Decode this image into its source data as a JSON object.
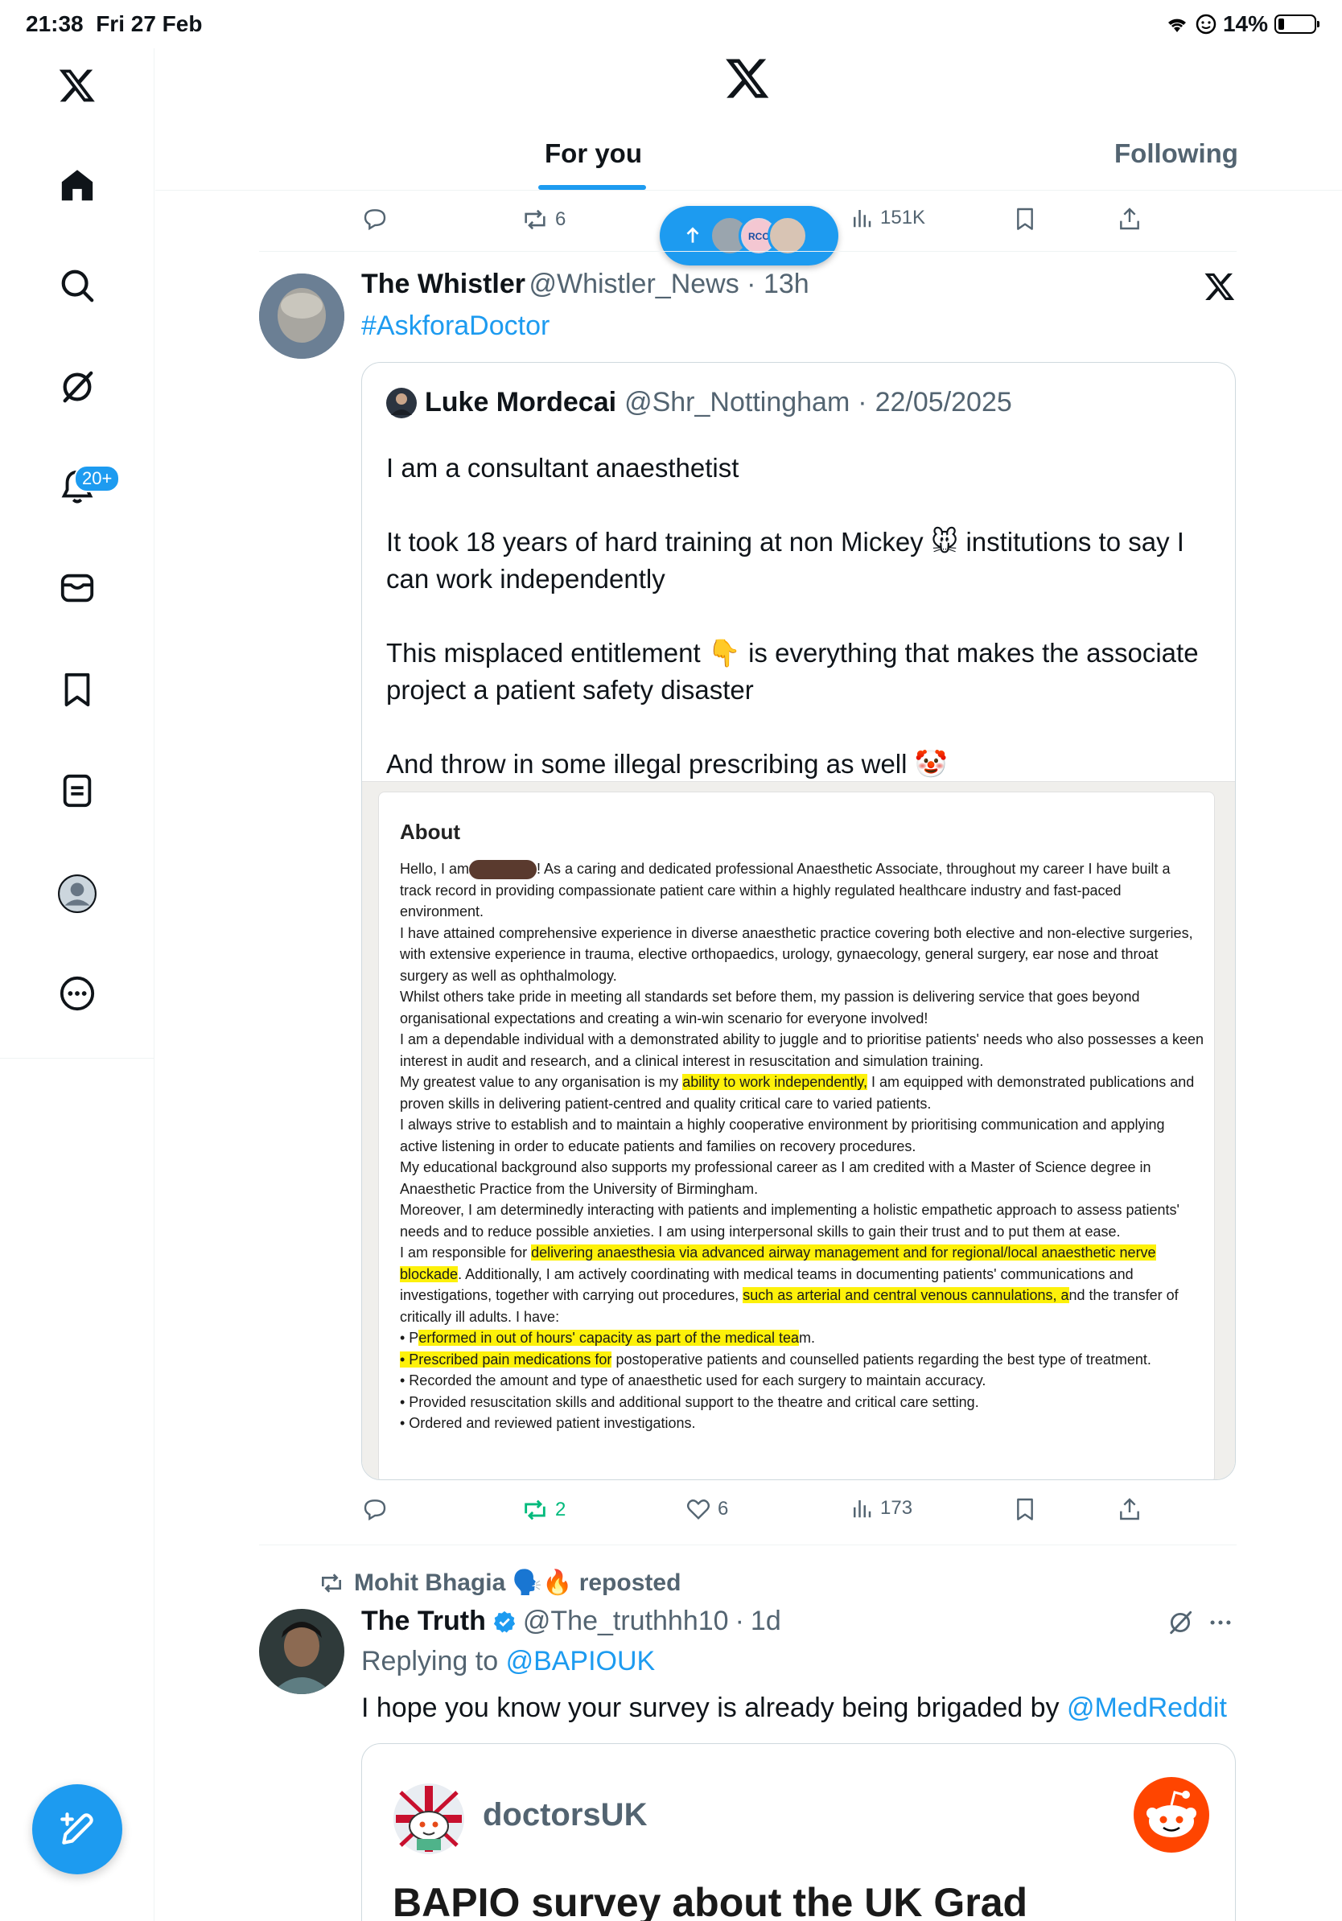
{
  "status_bar": {
    "time": "21:38",
    "date": "Fri 27 Feb",
    "battery": "14%"
  },
  "sidebar": {
    "notification_badge": "20+"
  },
  "tabs": {
    "for_you": "For you",
    "following": "Following"
  },
  "top_actions": {
    "retweets": "6",
    "views": "151K"
  },
  "post1": {
    "name": "The Whistler",
    "handle": "@Whistler_News",
    "time": "13h",
    "hashtag": "#AskforaDoctor",
    "quote": {
      "name": "Luke Mordecai",
      "handle": "@Shr_Nottingham",
      "date": "22/05/2025",
      "line1": "I am a consultant anaesthetist",
      "line2": "It took 18 years of hard training at non Mickey 🐭 institutions to say I can work independently",
      "line3": "This misplaced entitlement 👇 is everything that makes the associate project a patient safety disaster",
      "line4": "And throw in some illegal prescribing as well 🤡"
    },
    "image": {
      "heading": "About",
      "t01": "Hello, I am",
      "t02": "! As a caring and dedicated professional Anaesthetic Associate, throughout my career I have built a track record in providing compassionate patient care within a highly regulated healthcare industry and fast-paced environment.",
      "t03": "I have attained comprehensive experience in diverse anaesthetic practice covering both elective and non-elective surgeries, with extensive experience in trauma, elective orthopaedics, urology, gynaecology, general surgery, ear nose and throat surgery as well as ophthalmology.",
      "t04": "Whilst others take pride in meeting all standards set before them, my passion is delivering service that goes beyond organisational expectations and creating a win-win scenario for everyone involved!",
      "t05": "I am a dependable individual with a demonstrated ability to juggle and to prioritise patients' needs who also possesses a keen interest in audit and research, and a clinical interest in resuscitation and simulation training.",
      "t06": "My greatest value to any organisation is my",
      "t07": "ability to work independently,",
      "t08": "I am equipped with demonstrated publications and proven skills in delivering patient-centred and quality critical care to varied patients.",
      "t09": "I always strive to establish and to maintain a highly cooperative environment by prioritising communication and applying active listening in order to educate patients and families on recovery procedures.",
      "t10": "My educational background also supports my professional career as I am credited with a Master of Science degree in Anaesthetic Practice from the University of Birmingham.",
      "t11": "Moreover, I am determinedly interacting with patients and implementing a holistic empathetic approach to assess patients' needs and to reduce possible anxieties. I am using interpersonal skills to gain their trust and to put them at ease.",
      "t12": "I am responsible for",
      "t13": "delivering anaesthesia via advanced airway management and for regional/local anaesthetic nerve blockade",
      "t14": ". Additionally, I am actively coordinating with medical teams in documenting patients' communications and investigations, together with carrying out procedures,",
      "t15": "such as arterial and central venous cannulations, a",
      "t16": "nd the transfer of critically ill adults. I have:",
      "t17": "• P",
      "t18": "erformed in out of hours' capacity as part of the medical tea",
      "t19": "m.",
      "t20": "• Prescribed pain medications for",
      "t21": " postoperative patients and counselled patients regarding the best type of treatment.",
      "t22": "• Recorded the amount and type of anaesthetic used for each surgery to maintain accuracy.",
      "t23": "• Provided resuscitation skills and additional support to the theatre and critical care setting.",
      "t24": "• Ordered and reviewed patient investigations."
    },
    "actions": {
      "retweets": "2",
      "likes": "6",
      "views": "173"
    }
  },
  "post2": {
    "reposted_by": "Mohit Bhagia 🗣️🔥 reposted",
    "name": "The Truth",
    "handle": "@The_truthhh10",
    "time": "1d",
    "replying_prefix": "Replying to",
    "replying_to": "@BAPIOUK",
    "text_prefix": "I hope you know your survey is already being brigaded by",
    "text_mention": "@MedReddit",
    "quote_title": "doctorsUK",
    "quote_heading": "BAPIO survey about the UK Grad"
  },
  "colors": {
    "accent": "#1d9bf0",
    "retweet_green": "#00ba7c",
    "highlight": "#fdf10a"
  }
}
